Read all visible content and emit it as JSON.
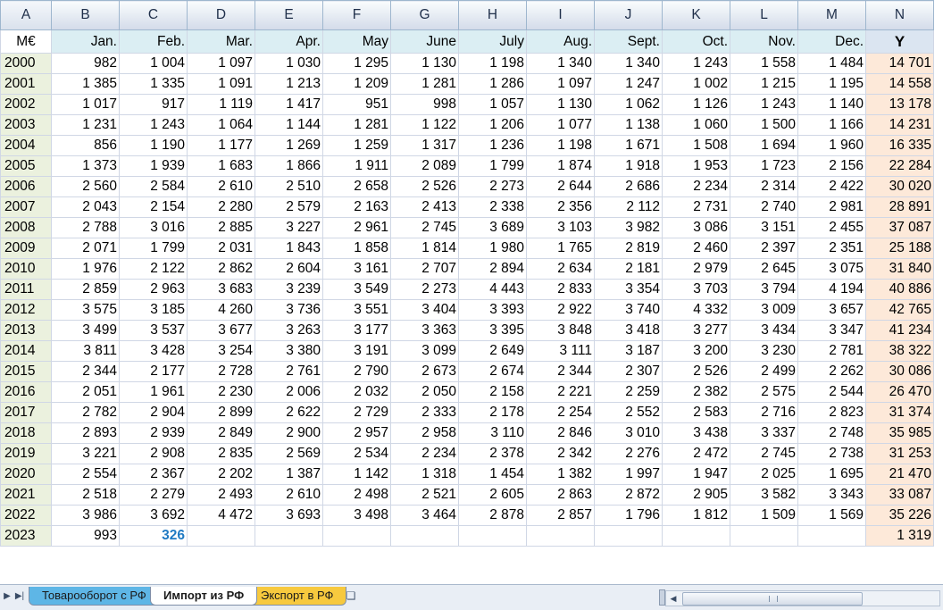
{
  "columns": [
    "A",
    "B",
    "C",
    "D",
    "E",
    "F",
    "G",
    "H",
    "I",
    "J",
    "K",
    "L",
    "M",
    "N"
  ],
  "header": {
    "unit": "M€",
    "months": [
      "Jan.",
      "Feb.",
      "Mar.",
      "Apr.",
      "May",
      "June",
      "July",
      "Aug.",
      "Sept.",
      "Oct.",
      "Nov.",
      "Dec."
    ],
    "total": "Y"
  },
  "rows": [
    {
      "year": "2000",
      "values": [
        "982",
        "1 004",
        "1 097",
        "1 030",
        "1 295",
        "1 130",
        "1 198",
        "1 340",
        "1 340",
        "1 243",
        "1 558",
        "1 484"
      ],
      "total": "14 701"
    },
    {
      "year": "2001",
      "values": [
        "1 385",
        "1 335",
        "1 091",
        "1 213",
        "1 209",
        "1 281",
        "1 286",
        "1 097",
        "1 247",
        "1 002",
        "1 215",
        "1 195"
      ],
      "total": "14 558"
    },
    {
      "year": "2002",
      "values": [
        "1 017",
        "917",
        "1 119",
        "1 417",
        "951",
        "998",
        "1 057",
        "1 130",
        "1 062",
        "1 126",
        "1 243",
        "1 140"
      ],
      "total": "13 178"
    },
    {
      "year": "2003",
      "values": [
        "1 231",
        "1 243",
        "1 064",
        "1 144",
        "1 281",
        "1 122",
        "1 206",
        "1 077",
        "1 138",
        "1 060",
        "1 500",
        "1 166"
      ],
      "total": "14 231"
    },
    {
      "year": "2004",
      "values": [
        "856",
        "1 190",
        "1 177",
        "1 269",
        "1 259",
        "1 317",
        "1 236",
        "1 198",
        "1 671",
        "1 508",
        "1 694",
        "1 960"
      ],
      "total": "16 335"
    },
    {
      "year": "2005",
      "values": [
        "1 373",
        "1 939",
        "1 683",
        "1 866",
        "1 911",
        "2 089",
        "1 799",
        "1 874",
        "1 918",
        "1 953",
        "1 723",
        "2 156"
      ],
      "total": "22 284"
    },
    {
      "year": "2006",
      "values": [
        "2 560",
        "2 584",
        "2 610",
        "2 510",
        "2 658",
        "2 526",
        "2 273",
        "2 644",
        "2 686",
        "2 234",
        "2 314",
        "2 422"
      ],
      "total": "30 020"
    },
    {
      "year": "2007",
      "values": [
        "2 043",
        "2 154",
        "2 280",
        "2 579",
        "2 163",
        "2 413",
        "2 338",
        "2 356",
        "2 112",
        "2 731",
        "2 740",
        "2 981"
      ],
      "total": "28 891"
    },
    {
      "year": "2008",
      "values": [
        "2 788",
        "3 016",
        "2 885",
        "3 227",
        "2 961",
        "2 745",
        "3 689",
        "3 103",
        "3 982",
        "3 086",
        "3 151",
        "2 455"
      ],
      "total": "37 087"
    },
    {
      "year": "2009",
      "values": [
        "2 071",
        "1 799",
        "2 031",
        "1 843",
        "1 858",
        "1 814",
        "1 980",
        "1 765",
        "2 819",
        "2 460",
        "2 397",
        "2 351"
      ],
      "total": "25 188"
    },
    {
      "year": "2010",
      "values": [
        "1 976",
        "2 122",
        "2 862",
        "2 604",
        "3 161",
        "2 707",
        "2 894",
        "2 634",
        "2 181",
        "2 979",
        "2 645",
        "3 075"
      ],
      "total": "31 840"
    },
    {
      "year": "2011",
      "values": [
        "2 859",
        "2 963",
        "3 683",
        "3 239",
        "3 549",
        "2 273",
        "4 443",
        "2 833",
        "3 354",
        "3 703",
        "3 794",
        "4 194"
      ],
      "total": "40 886"
    },
    {
      "year": "2012",
      "values": [
        "3 575",
        "3 185",
        "4 260",
        "3 736",
        "3 551",
        "3 404",
        "3 393",
        "2 922",
        "3 740",
        "4 332",
        "3 009",
        "3 657"
      ],
      "total": "42 765"
    },
    {
      "year": "2013",
      "values": [
        "3 499",
        "3 537",
        "3 677",
        "3 263",
        "3 177",
        "3 363",
        "3 395",
        "3 848",
        "3 418",
        "3 277",
        "3 434",
        "3 347"
      ],
      "total": "41 234"
    },
    {
      "year": "2014",
      "values": [
        "3 811",
        "3 428",
        "3 254",
        "3 380",
        "3 191",
        "3 099",
        "2 649",
        "3 111",
        "3 187",
        "3 200",
        "3 230",
        "2 781"
      ],
      "total": "38 322"
    },
    {
      "year": "2015",
      "values": [
        "2 344",
        "2 177",
        "2 728",
        "2 761",
        "2 790",
        "2 673",
        "2 674",
        "2 344",
        "2 307",
        "2 526",
        "2 499",
        "2 262"
      ],
      "total": "30 086"
    },
    {
      "year": "2016",
      "values": [
        "2 051",
        "1 961",
        "2 230",
        "2 006",
        "2 032",
        "2 050",
        "2 158",
        "2 221",
        "2 259",
        "2 382",
        "2 575",
        "2 544"
      ],
      "total": "26 470"
    },
    {
      "year": "2017",
      "values": [
        "2 782",
        "2 904",
        "2 899",
        "2 622",
        "2 729",
        "2 333",
        "2 178",
        "2 254",
        "2 552",
        "2 583",
        "2 716",
        "2 823"
      ],
      "total": "31 374"
    },
    {
      "year": "2018",
      "values": [
        "2 893",
        "2 939",
        "2 849",
        "2 900",
        "2 957",
        "2 958",
        "3 110",
        "2 846",
        "3 010",
        "3 438",
        "3 337",
        "2 748"
      ],
      "total": "35 985"
    },
    {
      "year": "2019",
      "values": [
        "3 221",
        "2 908",
        "2 835",
        "2 569",
        "2 534",
        "2 234",
        "2 378",
        "2 342",
        "2 276",
        "2 472",
        "2 745",
        "2 738"
      ],
      "total": "31 253"
    },
    {
      "year": "2020",
      "values": [
        "2 554",
        "2 367",
        "2 202",
        "1 387",
        "1 142",
        "1 318",
        "1 454",
        "1 382",
        "1 997",
        "1 947",
        "2 025",
        "1 695"
      ],
      "total": "21 470"
    },
    {
      "year": "2021",
      "values": [
        "2 518",
        "2 279",
        "2 493",
        "2 610",
        "2 498",
        "2 521",
        "2 605",
        "2 863",
        "2 872",
        "2 905",
        "3 582",
        "3 343"
      ],
      "total": "33 087"
    },
    {
      "year": "2022",
      "values": [
        "3 986",
        "3 692",
        "4 472",
        "3 693",
        "3 498",
        "3 464",
        "2 878",
        "2 857",
        "1 796",
        "1 812",
        "1 509",
        "1 569"
      ],
      "total": "35 226"
    },
    {
      "year": "2023",
      "values": [
        "993",
        "326",
        "",
        "",
        "",
        "",
        "",
        "",
        "",
        "",
        "",
        ""
      ],
      "total": "1 319"
    }
  ],
  "highlight_color": "#1f7ac3",
  "tabs": {
    "items": [
      "Товарооборот с РФ",
      "Импорт из РФ",
      "Экспорт в РФ"
    ],
    "active": "Импорт из РФ",
    "new_sheet_icon": "new-sheet-icon"
  }
}
